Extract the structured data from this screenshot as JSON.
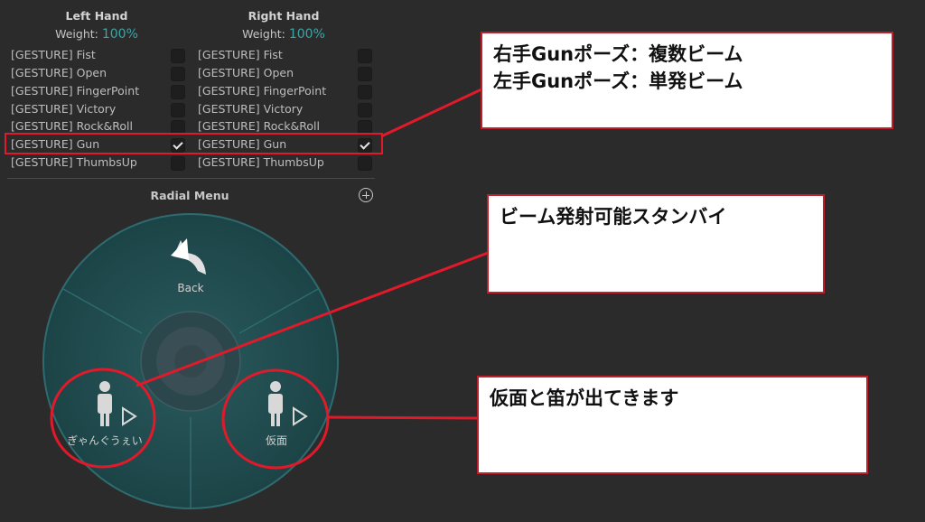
{
  "left_hand": {
    "title": "Left Hand",
    "weight_label": "Weight:",
    "weight_value": "100%"
  },
  "right_hand": {
    "title": "Right Hand",
    "weight_label": "Weight:",
    "weight_value": "100%"
  },
  "gestures": [
    {
      "label": "[GESTURE] Fist",
      "left_checked": false,
      "right_checked": false
    },
    {
      "label": "[GESTURE] Open",
      "left_checked": false,
      "right_checked": false
    },
    {
      "label": "[GESTURE] FingerPoint",
      "left_checked": false,
      "right_checked": false
    },
    {
      "label": "[GESTURE] Victory",
      "left_checked": false,
      "right_checked": false
    },
    {
      "label": "[GESTURE] Rock&Roll",
      "left_checked": false,
      "right_checked": false
    },
    {
      "label": "[GESTURE] Gun",
      "left_checked": true,
      "right_checked": true
    },
    {
      "label": "[GESTURE] ThumbsUp",
      "left_checked": false,
      "right_checked": false
    }
  ],
  "radial_menu": {
    "title": "Radial Menu",
    "back_label": "Back",
    "item_left_label": "ぎゃんぐうぇい",
    "item_right_label": "仮面",
    "colors": {
      "fill": "#1f4b4e",
      "stroke": "#2f6b6e",
      "center": "#3a4f55"
    }
  },
  "callouts": {
    "gun_pose_line1": "右手Gunポーズ：複数ビーム",
    "gun_pose_line2": "左手Gunポーズ：単発ビーム",
    "beam_standby": "ビーム発射可能スタンバイ",
    "mask_flute": "仮面と笛が出てきます"
  },
  "annotation_color": "#e01a2a"
}
